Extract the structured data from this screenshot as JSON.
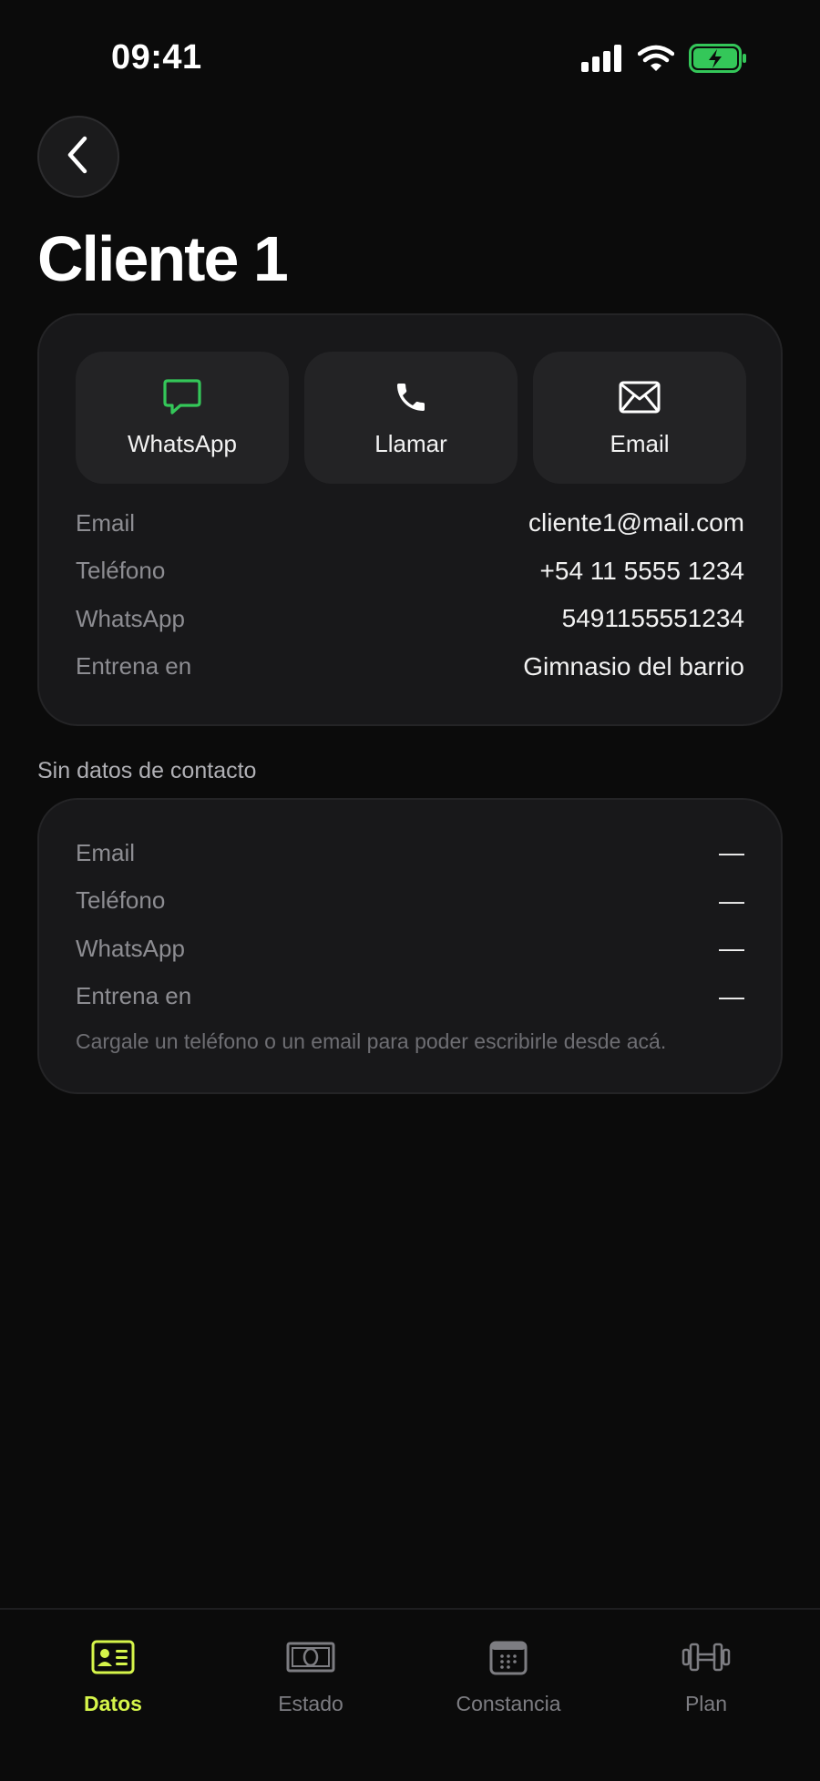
{
  "status_bar": {
    "time": "09:41"
  },
  "header": {
    "title": "Cliente 1"
  },
  "actions": [
    {
      "label": "WhatsApp",
      "icon": "chat-bubble-icon"
    },
    {
      "label": "Llamar",
      "icon": "phone-icon"
    },
    {
      "label": "Email",
      "icon": "mail-icon"
    }
  ],
  "contact": {
    "rows": [
      {
        "label": "Email",
        "value": "cliente1@mail.com"
      },
      {
        "label": "Teléfono",
        "value": "+54 11 5555 1234"
      },
      {
        "label": "WhatsApp",
        "value": "5491155551234"
      },
      {
        "label": "Entrena en",
        "value": "Gimnasio del barrio"
      }
    ]
  },
  "empty_section": {
    "title": "Sin datos de contacto",
    "rows": [
      {
        "label": "Email",
        "value": "—"
      },
      {
        "label": "Teléfono",
        "value": "—"
      },
      {
        "label": "WhatsApp",
        "value": "—"
      },
      {
        "label": "Entrena en",
        "value": "—"
      }
    ],
    "hint": "Cargale un teléfono o un email para poder escribirle desde acá."
  },
  "bottom_nav": [
    {
      "label": "Datos",
      "icon": "id-card-icon",
      "active": true
    },
    {
      "label": "Estado",
      "icon": "banknote-icon",
      "active": false
    },
    {
      "label": "Constancia",
      "icon": "calendar-icon",
      "active": false
    },
    {
      "label": "Plan",
      "icon": "dumbbell-icon",
      "active": false
    }
  ],
  "colors": {
    "background": "#0b0b0b",
    "card": "#18181a",
    "accent": "#d6f54a",
    "whatsapp_green": "#34c759",
    "battery_green": "#34c759"
  }
}
